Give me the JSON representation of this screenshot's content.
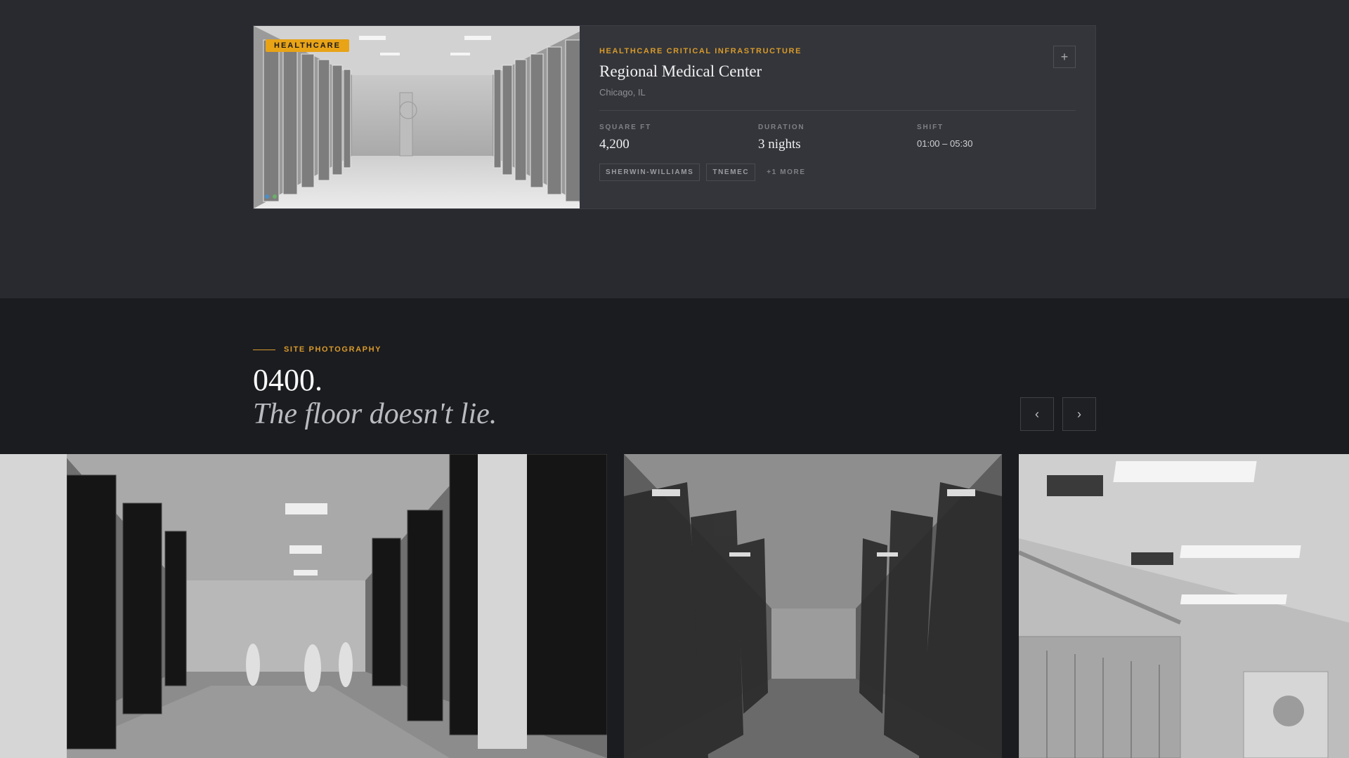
{
  "card": {
    "badge": "HEALTHCARE",
    "eyebrow": "HEALTHCARE CRITICAL INFRASTRUCTURE",
    "title": "Regional Medical Center",
    "location": "Chicago, IL",
    "plus_label": "+",
    "stats": [
      {
        "label": "SQUARE FT",
        "value": "4,200"
      },
      {
        "label": "DURATION",
        "value": "3 nights"
      },
      {
        "label": "SHIFT",
        "value": "01:00 – 05:30"
      }
    ],
    "tags": [
      "SHERWIN-WILLIAMS",
      "TNEMEC"
    ],
    "more": "+1 MORE"
  },
  "gallery": {
    "eyebrow": "SITE PHOTOGRAPHY",
    "heading": "0400.",
    "subheading": "The floor doesn't lie.",
    "prev_label": "‹",
    "next_label": "›"
  },
  "colors": {
    "accent": "#e8a317",
    "background_top": "#282a2f",
    "background_bottom": "#1b1c20",
    "card": "#33353a"
  }
}
